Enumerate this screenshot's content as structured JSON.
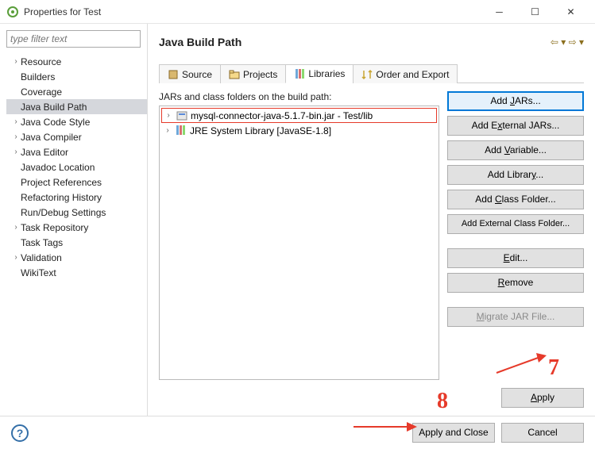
{
  "window": {
    "title": "Properties for Test"
  },
  "filter": {
    "placeholder": "type filter text"
  },
  "tree": [
    {
      "label": "Resource",
      "expandable": true
    },
    {
      "label": "Builders",
      "expandable": false
    },
    {
      "label": "Coverage",
      "expandable": false
    },
    {
      "label": "Java Build Path",
      "expandable": false,
      "selected": true
    },
    {
      "label": "Java Code Style",
      "expandable": true
    },
    {
      "label": "Java Compiler",
      "expandable": true
    },
    {
      "label": "Java Editor",
      "expandable": true
    },
    {
      "label": "Javadoc Location",
      "expandable": false
    },
    {
      "label": "Project References",
      "expandable": false
    },
    {
      "label": "Refactoring History",
      "expandable": false
    },
    {
      "label": "Run/Debug Settings",
      "expandable": false
    },
    {
      "label": "Task Repository",
      "expandable": true
    },
    {
      "label": "Task Tags",
      "expandable": false
    },
    {
      "label": "Validation",
      "expandable": true
    },
    {
      "label": "WikiText",
      "expandable": false
    }
  ],
  "content": {
    "title": "Java Build Path"
  },
  "tabs": [
    {
      "label": "Source",
      "icon": "source"
    },
    {
      "label": "Projects",
      "icon": "projects"
    },
    {
      "label": "Libraries",
      "icon": "libraries",
      "active": true
    },
    {
      "label": "Order and Export",
      "icon": "order"
    }
  ],
  "jarPanel": {
    "label": "JARs and class folders on the build path:",
    "items": [
      {
        "label": "mysql-connector-java-5.1.7-bin.jar - Test/lib",
        "icon": "jar",
        "highlighted": true
      },
      {
        "label": "JRE System Library [JavaSE-1.8]",
        "icon": "jre"
      }
    ]
  },
  "buttons": {
    "addJars": "Add JARs...",
    "addExternalJars": "Add External JARs...",
    "addVariable": "Add Variable...",
    "addLibrary": "Add Library...",
    "addClassFolder": "Add Class Folder...",
    "addExternalClassFolder": "Add External Class Folder...",
    "edit": "Edit...",
    "remove": "Remove",
    "migrate": "Migrate JAR File...",
    "apply": "Apply",
    "applyClose": "Apply and Close",
    "cancel": "Cancel"
  },
  "annotations": {
    "seven": "7",
    "eight": "8"
  }
}
